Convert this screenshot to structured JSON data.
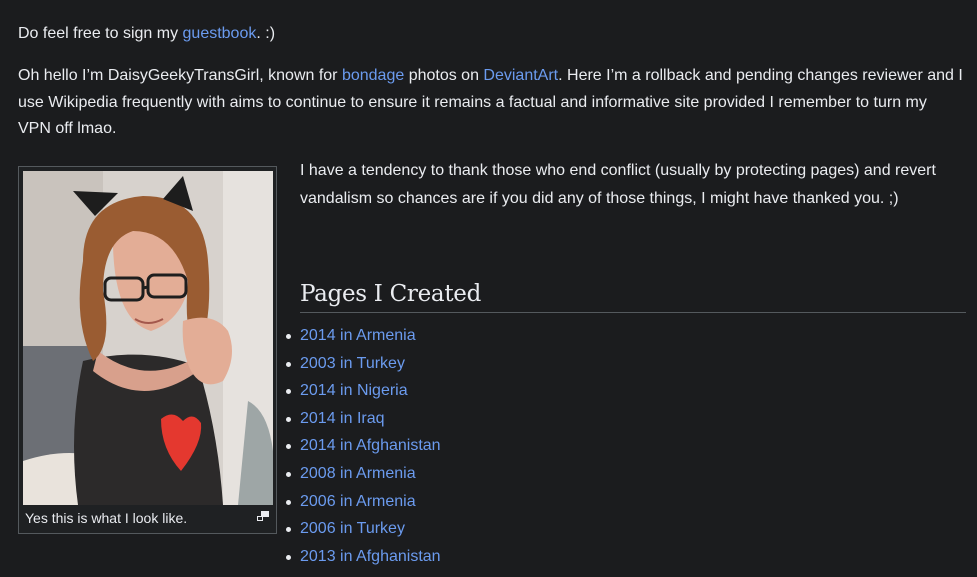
{
  "intro": {
    "line1_before": "Do feel free to sign my ",
    "guestbook_link": "guestbook",
    "line1_after": ". :)"
  },
  "bio": {
    "before_bondage": "Oh hello I’m DaisyGeekyTransGirl, known for ",
    "bondage_link": "bondage",
    "middle": " photos on ",
    "deviantart_link": "DeviantArt",
    "after": ". Here I’m a rollback and pending changes reviewer and I use Wikipedia frequently with aims to continue to ensure it remains a factual and informative site provided I remember to turn my VPN off lmao."
  },
  "thanks_text": "I have a tendency to thank those who end conflict (usually by protecting pages) and revert vandalism so chances are if you did any of those things, I might have thanked you. ;)",
  "image": {
    "caption": "Yes this is what I look like.",
    "enlarge_icon": "magnify-icon"
  },
  "pages_section": {
    "heading": "Pages I Created",
    "items": [
      "2014 in Armenia",
      "2003 in Turkey",
      "2014 in Nigeria",
      "2014 in Iraq",
      "2014 in Afghanistan",
      "2008 in Armenia",
      "2006 in Armenia",
      "2006 in Turkey",
      "2013 in Afghanistan"
    ]
  },
  "colors": {
    "background": "#1b1c1e",
    "text": "#eaecf0",
    "link": "#6b9bef"
  }
}
